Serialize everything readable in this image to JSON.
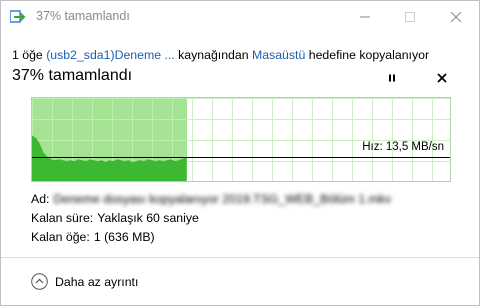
{
  "window": {
    "title": "37% tamamlandı"
  },
  "copy": {
    "prefix": "1 öğe ",
    "source": "(usb2_sda1)Deneme ...",
    "middle": " kaynağından ",
    "destination": "Masaüstü",
    "suffix": " hedefine kopyalanıyor"
  },
  "progress": {
    "heading": "37%  tamamlandı",
    "percent": 37
  },
  "graph": {
    "speed_label": "Hız: 13,5 MB/sn",
    "speed_level": 0.29,
    "throughput_history": [
      0.55,
      0.52,
      0.45,
      0.34,
      0.29,
      0.26,
      0.25,
      0.26,
      0.25,
      0.24,
      0.25,
      0.24,
      0.26,
      0.25,
      0.24,
      0.26,
      0.25,
      0.24,
      0.25,
      0.23,
      0.25,
      0.24,
      0.26,
      0.25,
      0.24,
      0.25,
      0.23,
      0.24,
      0.25,
      0.24,
      0.26,
      0.25,
      0.24,
      0.25,
      0.24,
      0.25,
      0.26,
      0.24,
      0.25,
      0.27,
      0.28
    ],
    "colors": {
      "fill": "#a4e393",
      "curve": "#3cb832",
      "border": "#a8d9a0",
      "speed_line": "#000000"
    }
  },
  "details": {
    "name_label": "Ad:",
    "name_value": "Deneme dosyası kopyalanıyor 2019.TSG_WEB_Bölüm 1.mkv",
    "time_label": "Kalan süre:",
    "time_value": "Yaklaşık 60 saniye",
    "items_label": "Kalan öğe:",
    "items_value": "1 (636 MB)"
  },
  "footer": {
    "less_details_label": "Daha az ayrıntı"
  },
  "icons": {
    "title": "copy-arrow-icon",
    "minimize": "minimize-icon",
    "maximize": "maximize-icon",
    "close": "close-icon",
    "pause": "pause-icon",
    "cancel": "cancel-icon",
    "chevron": "chevron-up-circle-icon"
  },
  "colors": {
    "link": "#1a5fb4",
    "title_text": "#8a8a8a",
    "icon_blue": "#2b79d8",
    "icon_green": "#35a73b"
  }
}
